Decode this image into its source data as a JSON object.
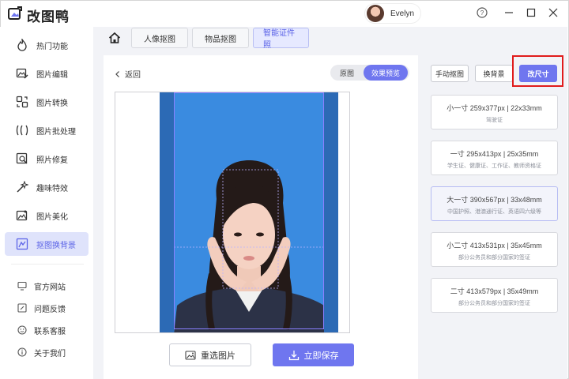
{
  "app": {
    "title": "改图鸭",
    "user_name": "Evelyn"
  },
  "window_controls": {
    "help": "?",
    "minimize": "—",
    "maximize": "☐",
    "close": "✕"
  },
  "sidebar": {
    "items": [
      {
        "label": "热门功能",
        "icon": "fire-icon"
      },
      {
        "label": "图片编辑",
        "icon": "image-edit-icon"
      },
      {
        "label": "图片转换",
        "icon": "convert-icon"
      },
      {
        "label": "图片批处理",
        "icon": "batch-icon"
      },
      {
        "label": "照片修复",
        "icon": "repair-icon"
      },
      {
        "label": "趣味特效",
        "icon": "magic-icon"
      },
      {
        "label": "图片美化",
        "icon": "beautify-icon"
      },
      {
        "label": "抠图换背景",
        "icon": "cutout-icon",
        "active": true
      }
    ],
    "links": [
      {
        "label": "官方网站",
        "icon": "monitor-icon"
      },
      {
        "label": "问题反馈",
        "icon": "feedback-icon"
      },
      {
        "label": "联系客服",
        "icon": "service-icon"
      },
      {
        "label": "关于我们",
        "icon": "info-icon"
      }
    ]
  },
  "tabs": [
    {
      "label": "人像抠图"
    },
    {
      "label": "物品抠图"
    },
    {
      "label": "智能证件照",
      "active": true
    }
  ],
  "editor": {
    "back_label": "返回",
    "view_toggle": {
      "original": "原图",
      "preview": "效果预览",
      "active": "preview"
    },
    "reselect_label": "重选图片",
    "save_label": "立即保存",
    "background_color": "#3a8be0"
  },
  "right_panel": {
    "tools": [
      {
        "label": "手动抠图"
      },
      {
        "label": "换背景"
      },
      {
        "label": "改尺寸",
        "active": true
      }
    ],
    "sizes": [
      {
        "title": "小一寸 259x377px | 22x33mm",
        "desc": "驾驶证"
      },
      {
        "title": "一寸 295x413px | 25x35mm",
        "desc": "学生证、健康证、工作证、教师资格证"
      },
      {
        "title": "大一寸 390x567px | 33x48mm",
        "desc": "中国护照、港澳通行证、英语四六级等",
        "selected": true
      },
      {
        "title": "小二寸 413x531px | 35x45mm",
        "desc": "部分公务员和部分国家的签证"
      },
      {
        "title": "二寸 413x579px | 35x49mm",
        "desc": "部分公务员和部分国家的签证"
      }
    ]
  },
  "colors": {
    "accent": "#6f76ef",
    "highlight": "#e01c1c",
    "active_bg": "#dfe3fb"
  }
}
